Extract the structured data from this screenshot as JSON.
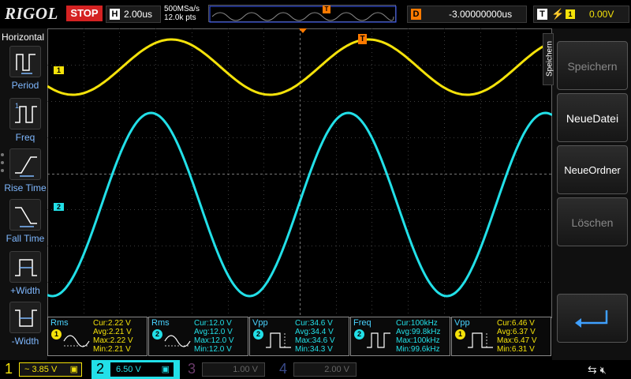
{
  "header": {
    "brand": "RIGOL",
    "run_state": "STOP",
    "horizontal_letter": "H",
    "timebase": "2.00us",
    "sample_rate": "500MSa/s",
    "memory_depth": "12.0k pts",
    "overview_trigger_letter": "T",
    "delay_letter": "D",
    "delay_value": "-3.00000000us",
    "trigger_letter": "T",
    "trigger_source": "1",
    "trigger_level": "0.00V"
  },
  "left_menu": {
    "title": "Horizontal",
    "items": [
      {
        "label": "Period",
        "icon": "period-icon"
      },
      {
        "label": "Freq",
        "icon": "frequency-icon"
      },
      {
        "label": "Rise Time",
        "icon": "rise-time-icon"
      },
      {
        "label": "Fall Time",
        "icon": "fall-time-icon"
      },
      {
        "label": "+Width",
        "icon": "positive-width-icon"
      },
      {
        "label": "-Width",
        "icon": "negative-width-icon"
      }
    ]
  },
  "screen": {
    "trigger_marker": "T",
    "ch1_marker": "1",
    "ch2_marker": "2"
  },
  "measurements": [
    {
      "title": "Rms",
      "channel": "1",
      "color": "#f4e20a",
      "cur": "Cur:2.22 V",
      "avg": "Avg:2.21 V",
      "max": "Max:2.22 V",
      "min": "Min:2.21 V"
    },
    {
      "title": "Rms",
      "channel": "2",
      "color": "#22e0e8",
      "cur": "Cur:12.0 V",
      "avg": "Avg:12.0 V",
      "max": "Max:12.0 V",
      "min": "Min:12.0 V"
    },
    {
      "title": "Vpp",
      "channel": "2",
      "color": "#22e0e8",
      "cur": "Cur:34.6 V",
      "avg": "Avg:34.4 V",
      "max": "Max:34.6 V",
      "min": "Min:34.3 V"
    },
    {
      "title": "Freq",
      "channel": "2",
      "color": "#22e0e8",
      "cur": "Cur:100kHz",
      "avg": "Avg:99.8kHz",
      "max": "Max:100kHz",
      "min": "Min:99.6kHz"
    },
    {
      "title": "Vpp",
      "channel": "1",
      "color": "#f4e20a",
      "cur": "Cur:6.46 V",
      "avg": "Avg:6.37 V",
      "max": "Max:6.47 V",
      "min": "Min:6.31 V"
    }
  ],
  "right_menu": {
    "tab_label": "Speichern",
    "buttons": [
      {
        "label": "Speichern",
        "enabled": false
      },
      {
        "label": "NeueDatei",
        "enabled": true
      },
      {
        "label": "NeueOrdner",
        "enabled": true
      },
      {
        "label": "Löschen",
        "enabled": false
      }
    ]
  },
  "channels": [
    {
      "number": "1",
      "scale": "3.85 V",
      "coupling_symbol": "~",
      "color": "#f4e20a",
      "active": true
    },
    {
      "number": "2",
      "scale": "6.50 V",
      "coupling_symbol": "",
      "color": "#22e0e8",
      "active": true
    },
    {
      "number": "3",
      "scale": "1.00 V",
      "coupling_symbol": "",
      "color": "#c040c0",
      "active": false
    },
    {
      "number": "4",
      "scale": "2.00 V",
      "coupling_symbol": "",
      "color": "#4a6cff",
      "active": false
    }
  ],
  "colors": {
    "ch1": "#f4e20a",
    "ch2": "#22e0e8",
    "trigger": "#ff7a00",
    "accent": "#7fb8ff"
  }
}
